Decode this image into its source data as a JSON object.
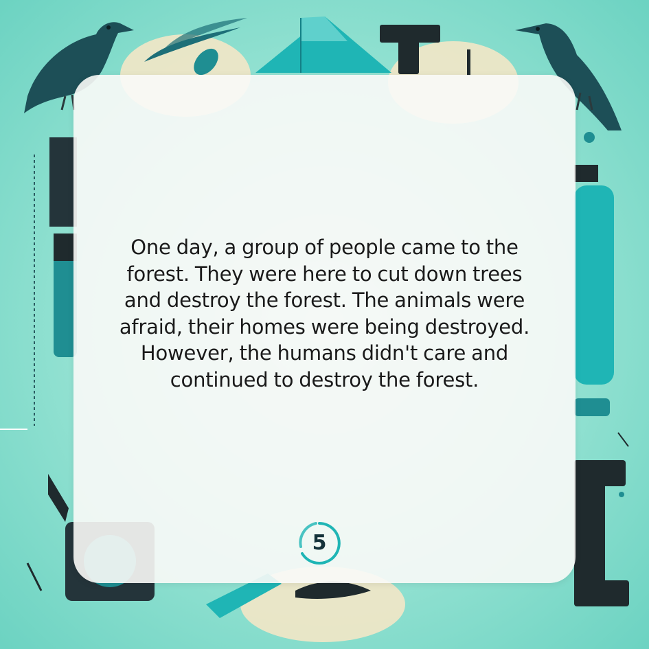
{
  "story": {
    "lines": [
      "One day, a group of people came to the",
      "forest. They were here to cut down trees",
      "and destroy the forest. The animals were",
      "afraid, their homes were being destroyed.",
      "However, the humans didn't care and",
      "continued to destroy the forest."
    ]
  },
  "page_number": "5",
  "colors": {
    "background": "#7fd8c9",
    "accent_teal": "#1fb5b5",
    "dark_teal": "#1d4f57",
    "panel": "#fafaf7",
    "text": "#1a1a1a"
  },
  "icons": [
    "crow-left",
    "crow-right",
    "triangle",
    "gear",
    "bottle",
    "pencil",
    "ruler",
    "leaf"
  ]
}
